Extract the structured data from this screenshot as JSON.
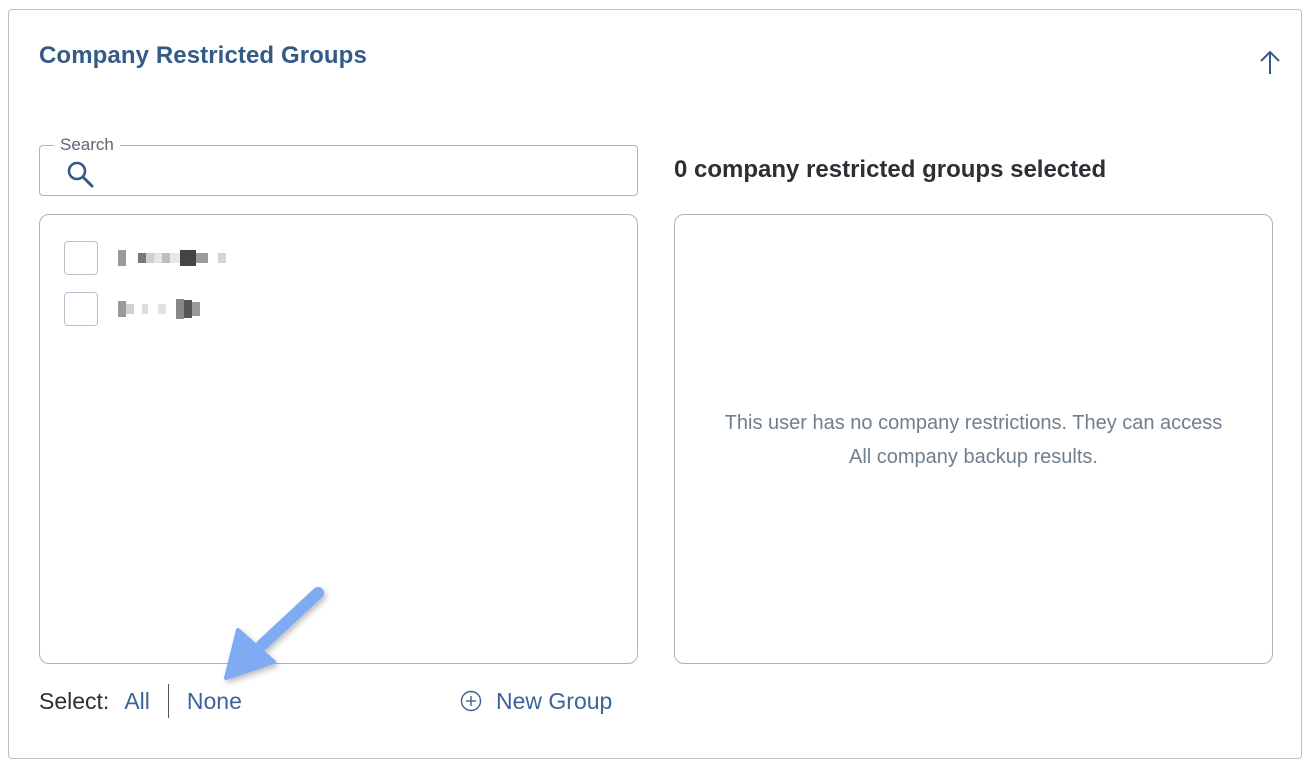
{
  "panel": {
    "title": "Company Restricted Groups",
    "collapse_icon": "arrow-up-icon"
  },
  "search": {
    "label": "Search",
    "value": "",
    "placeholder": "",
    "icon": "search-icon"
  },
  "available_groups": {
    "items": [
      {
        "checked": false
      },
      {
        "checked": false
      }
    ]
  },
  "selected_groups": {
    "heading": "0 company restricted groups selected",
    "empty_line1": "This user has no company restrictions. They can access",
    "empty_line2": "All company backup results."
  },
  "select_controls": {
    "label": "Select:",
    "all": "All",
    "none": "None"
  },
  "new_group": {
    "label": "New Group",
    "icon": "plus-circle-icon"
  },
  "colors": {
    "accent": "#345b88",
    "link": "#3c6495",
    "annotation_arrow": "#7fabf2"
  }
}
